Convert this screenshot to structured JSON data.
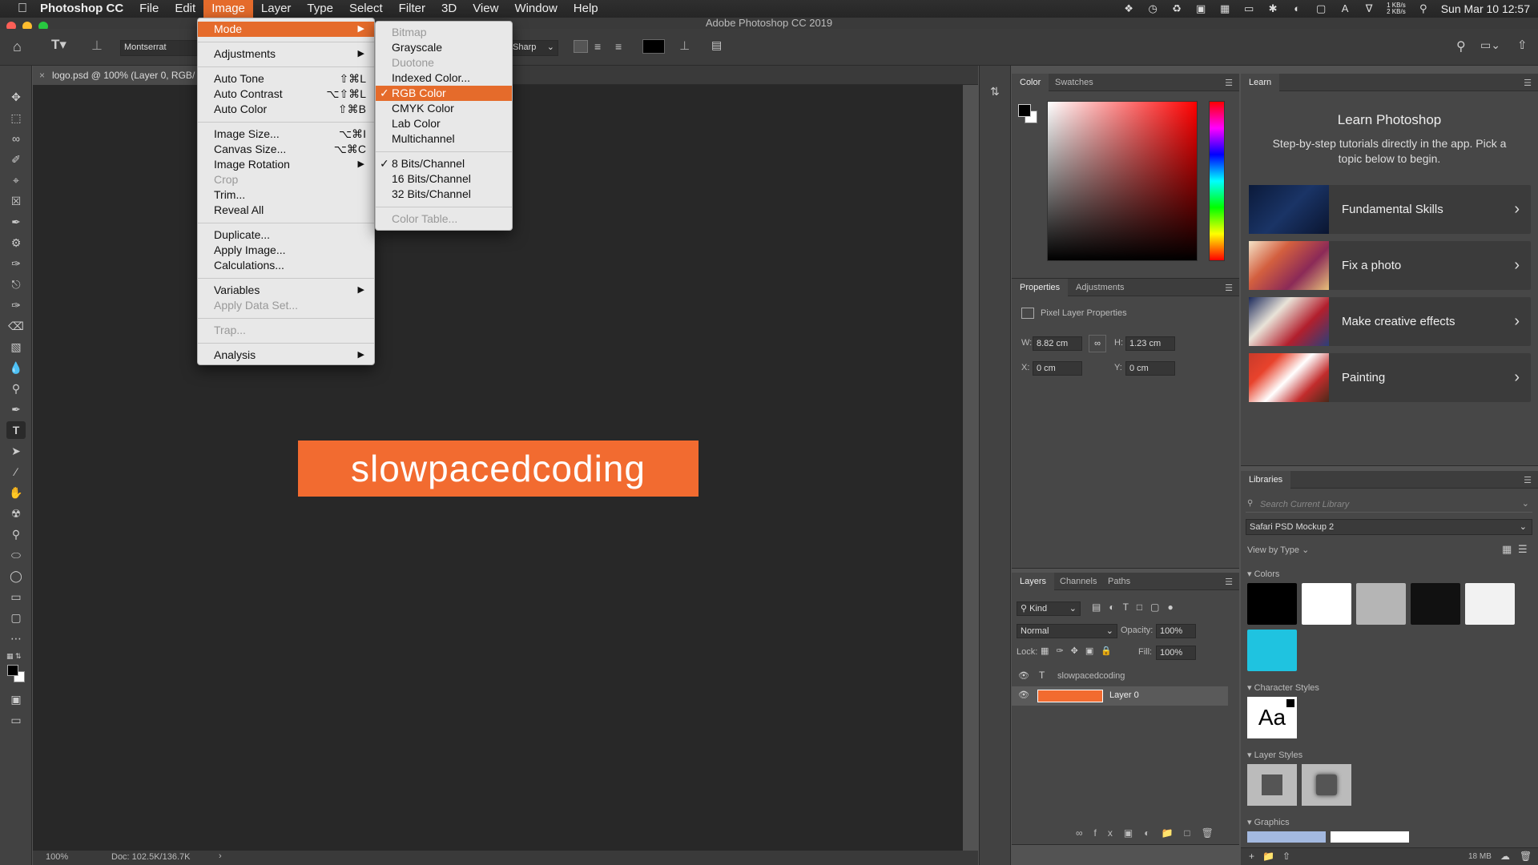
{
  "menubar": {
    "app": "Photoshop CC",
    "items": [
      "File",
      "Edit",
      "Image",
      "Layer",
      "Type",
      "Select",
      "Filter",
      "3D",
      "View",
      "Window",
      "Help"
    ],
    "active": "Image",
    "net_up": "1 KB/s",
    "net_down": "2 KB/s",
    "datetime": "Sun Mar 10  12:57"
  },
  "window": {
    "title": "Adobe Photoshop CC 2019"
  },
  "options": {
    "font": "Montserrat",
    "antialias": "Sharp"
  },
  "document": {
    "tab": "logo.psd @ 100% (Layer 0, RGB/",
    "logo_text": "slowpacedcoding",
    "logo_color": "#f26b30",
    "zoom": "100%",
    "doc_size": "Doc: 102.5K/136.7K"
  },
  "image_menu": {
    "items": [
      {
        "label": "Mode",
        "arrow": true,
        "hl": true
      },
      {
        "sep": true
      },
      {
        "label": "Adjustments",
        "arrow": true
      },
      {
        "sep": true
      },
      {
        "label": "Auto Tone",
        "shortcut": "⇧⌘L"
      },
      {
        "label": "Auto Contrast",
        "shortcut": "⌥⇧⌘L"
      },
      {
        "label": "Auto Color",
        "shortcut": "⇧⌘B"
      },
      {
        "sep": true
      },
      {
        "label": "Image Size...",
        "shortcut": "⌥⌘I"
      },
      {
        "label": "Canvas Size...",
        "shortcut": "⌥⌘C"
      },
      {
        "label": "Image Rotation",
        "arrow": true
      },
      {
        "label": "Crop",
        "disabled": true
      },
      {
        "label": "Trim..."
      },
      {
        "label": "Reveal All"
      },
      {
        "sep": true
      },
      {
        "label": "Duplicate..."
      },
      {
        "label": "Apply Image..."
      },
      {
        "label": "Calculations..."
      },
      {
        "sep": true
      },
      {
        "label": "Variables",
        "arrow": true
      },
      {
        "label": "Apply Data Set...",
        "disabled": true
      },
      {
        "sep": true
      },
      {
        "label": "Trap...",
        "disabled": true
      },
      {
        "sep": true
      },
      {
        "label": "Analysis",
        "arrow": true
      }
    ]
  },
  "mode_menu": {
    "items": [
      {
        "label": "Bitmap",
        "disabled": true
      },
      {
        "label": "Grayscale"
      },
      {
        "label": "Duotone",
        "disabled": true
      },
      {
        "label": "Indexed Color..."
      },
      {
        "label": "RGB Color",
        "checked": true,
        "hl": true
      },
      {
        "label": "CMYK Color"
      },
      {
        "label": "Lab Color"
      },
      {
        "label": "Multichannel"
      },
      {
        "sep": true
      },
      {
        "label": "8 Bits/Channel",
        "checked": true
      },
      {
        "label": "16 Bits/Channel"
      },
      {
        "label": "32 Bits/Channel"
      },
      {
        "sep": true
      },
      {
        "label": "Color Table...",
        "disabled": true
      }
    ]
  },
  "color_panel": {
    "tabs": [
      "Color",
      "Swatches"
    ]
  },
  "properties_panel": {
    "tabs": [
      "Properties",
      "Adjustments"
    ],
    "heading": "Pixel Layer Properties",
    "w_label": "W:",
    "w": "8.82 cm",
    "h_label": "H:",
    "h": "1.23 cm",
    "x_label": "X:",
    "x": "0 cm",
    "y_label": "Y:",
    "y": "0 cm"
  },
  "layers_panel": {
    "tabs": [
      "Layers",
      "Channels",
      "Paths"
    ],
    "filter": "Kind",
    "blend": "Normal",
    "opacity_label": "Opacity:",
    "opacity": "100%",
    "lock_label": "Lock:",
    "fill_label": "Fill:",
    "fill": "100%",
    "layers": [
      {
        "name": "slowpacedcoding",
        "type": "text"
      },
      {
        "name": "Layer 0",
        "type": "pixel",
        "selected": true
      }
    ]
  },
  "learn_panel": {
    "tab": "Learn",
    "title": "Learn Photoshop",
    "desc": "Step-by-step tutorials directly in the app. Pick a topic below to begin.",
    "items": [
      "Fundamental Skills",
      "Fix a photo",
      "Make creative effects",
      "Painting"
    ]
  },
  "libraries_panel": {
    "tab": "Libraries",
    "search_placeholder": "Search Current Library",
    "library": "Safari PSD Mockup 2",
    "view_by": "View by Type",
    "sections": [
      "Colors",
      "Character Styles",
      "Layer Styles",
      "Graphics"
    ],
    "colors": [
      "#000000",
      "#ffffff",
      "#b5b5b5",
      "#111111",
      "#f2f2f2",
      "#1fc3e0"
    ],
    "char_style": "Aa",
    "size": "18 MB"
  }
}
